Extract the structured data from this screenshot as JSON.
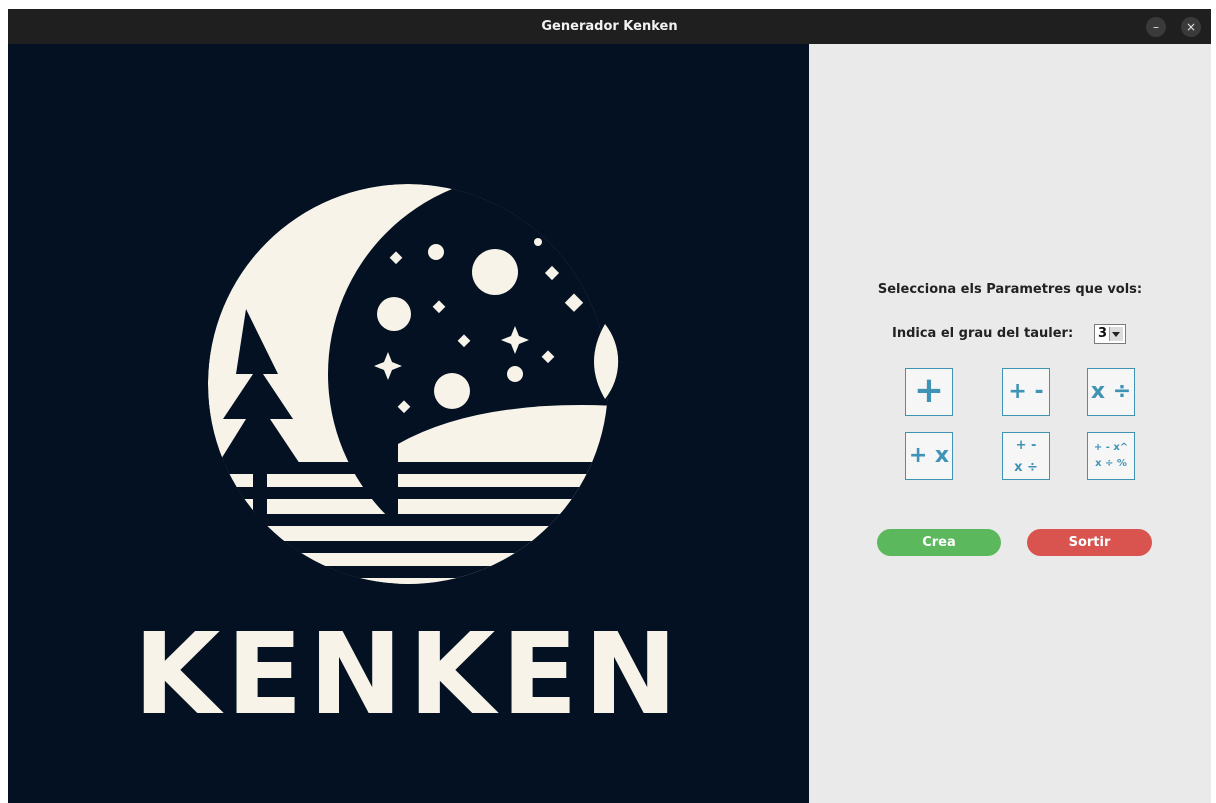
{
  "window": {
    "title": "Generador Kenken",
    "minimize_label": "–",
    "close_label": "×"
  },
  "logo": {
    "text": "KENKEN"
  },
  "panel": {
    "prompt": "Selecciona els Parametres que vols:",
    "grade_label": "Indica el grau del tauler:",
    "grade_value": "3",
    "operations": [
      {
        "label": "+"
      },
      {
        "label": "+ -"
      },
      {
        "label": "x ÷"
      },
      {
        "label": "+ x"
      },
      {
        "row1": "+  -",
        "row2": "x  ÷"
      },
      {
        "row1": "+  -  x^",
        "row2": "x  ÷  %"
      }
    ],
    "create_label": "Crea",
    "exit_label": "Sortir"
  },
  "colors": {
    "logo_background": "#031122",
    "logo_foreground": "#f7f3e8",
    "accent_blue": "#3f93b5",
    "create_green": "#5cb85c",
    "exit_red": "#d9534f",
    "panel_bg": "#eaeaea"
  }
}
